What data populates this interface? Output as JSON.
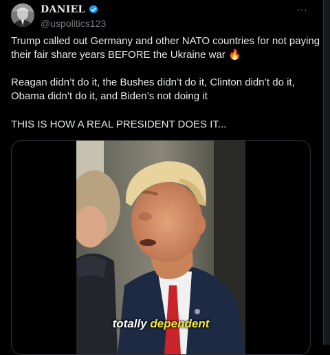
{
  "author": {
    "name": "DANIEL",
    "handle": "@uspolitics123",
    "verified_color": "#1d9bf0"
  },
  "menu": {
    "more_label": "···",
    "more_icon": "more-horizontal-icon"
  },
  "tweet": {
    "paragraph_1": "Trump called out Germany and other NATO countries for not paying their fair share years BEFORE the Ukraine war 🔥",
    "paragraph_2": "Reagan didn’t do it, the Bushes didn’t do it, Clinton didn’t do it, Obama didn’t do it, and Biden’s not doing it",
    "paragraph_3": "THIS IS HOW A REAL PRESIDENT DOES IT..."
  },
  "video": {
    "caption_word_1": "totally",
    "caption_word_2": "dependent",
    "highlight_color": "#f5e93a"
  }
}
